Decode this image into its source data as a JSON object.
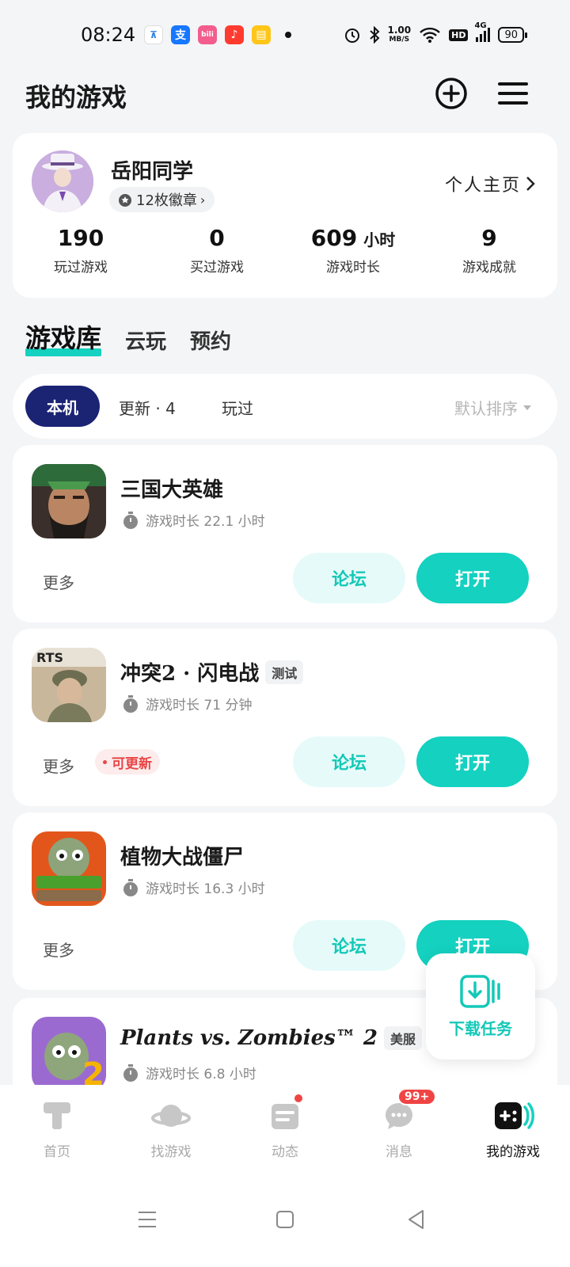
{
  "status_bar": {
    "time": "08:24",
    "speed_top": "1.00",
    "speed_bottom": "MB/S",
    "hd": "HD",
    "network": "4G",
    "battery": "90"
  },
  "header": {
    "title": "我的游戏"
  },
  "profile": {
    "username": "岳阳同学",
    "badges": "12枚徽章",
    "homepage_link": "个人主页",
    "stats": [
      {
        "value": "190",
        "unit": "",
        "label": "玩过游戏"
      },
      {
        "value": "0",
        "unit": "",
        "label": "买过游戏"
      },
      {
        "value": "609",
        "unit": "小时",
        "label": "游戏时长"
      },
      {
        "value": "9",
        "unit": "",
        "label": "游戏成就"
      }
    ]
  },
  "tabs": [
    "游戏库",
    "云玩",
    "预约"
  ],
  "filter": {
    "active": "本机",
    "update": "更新 · 4",
    "played": "玩过",
    "sort": "默认排序"
  },
  "games": [
    {
      "name": "三国大英雄",
      "tag": "",
      "playtime": "游戏时长  22.1  小时",
      "more": "更多",
      "update_badge": "",
      "forum": "论坛",
      "open": "打开"
    },
    {
      "name": "冲突2 · 闪电战",
      "tag": "测试",
      "playtime": "游戏时长  71  分钟",
      "more": "更多",
      "update_badge": "可更新",
      "forum": "论坛",
      "open": "打开"
    },
    {
      "name": "植物大战僵尸",
      "tag": "",
      "playtime": "游戏时长  16.3  小时",
      "more": "更多",
      "update_badge": "",
      "forum": "论坛",
      "open": "打开"
    },
    {
      "name": "Plants vs. Zombies™ 2",
      "tag": "美服",
      "playtime": "游戏时长  6.8  小时",
      "more": "",
      "update_badge": "",
      "forum": "",
      "open": ""
    }
  ],
  "download_fab": {
    "label": "下载任务"
  },
  "bottom_nav": [
    {
      "label": "首页",
      "icon": "home-icon"
    },
    {
      "label": "找游戏",
      "icon": "planet-icon"
    },
    {
      "label": "动态",
      "icon": "feed-icon"
    },
    {
      "label": "消息",
      "icon": "message-icon",
      "badge": "99+"
    },
    {
      "label": "我的游戏",
      "icon": "gamepad-icon"
    }
  ],
  "colors": {
    "accent": "#14d1c0",
    "navy": "#1b2373",
    "alert": "#f04444"
  }
}
